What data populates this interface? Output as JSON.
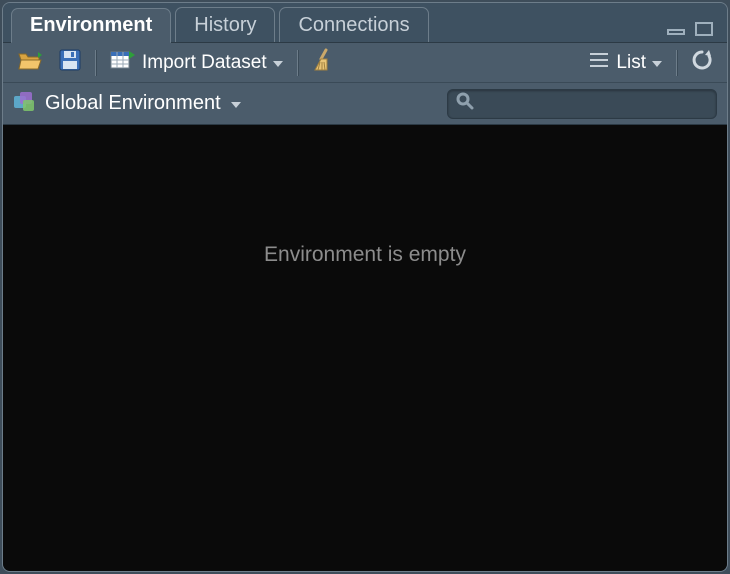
{
  "tabs": {
    "environment": "Environment",
    "history": "History",
    "connections": "Connections",
    "active": "environment"
  },
  "toolbar": {
    "import_label": "Import Dataset",
    "view_mode": "List"
  },
  "scope": {
    "label": "Global Environment",
    "search_placeholder": ""
  },
  "empty_message": "Environment is empty"
}
